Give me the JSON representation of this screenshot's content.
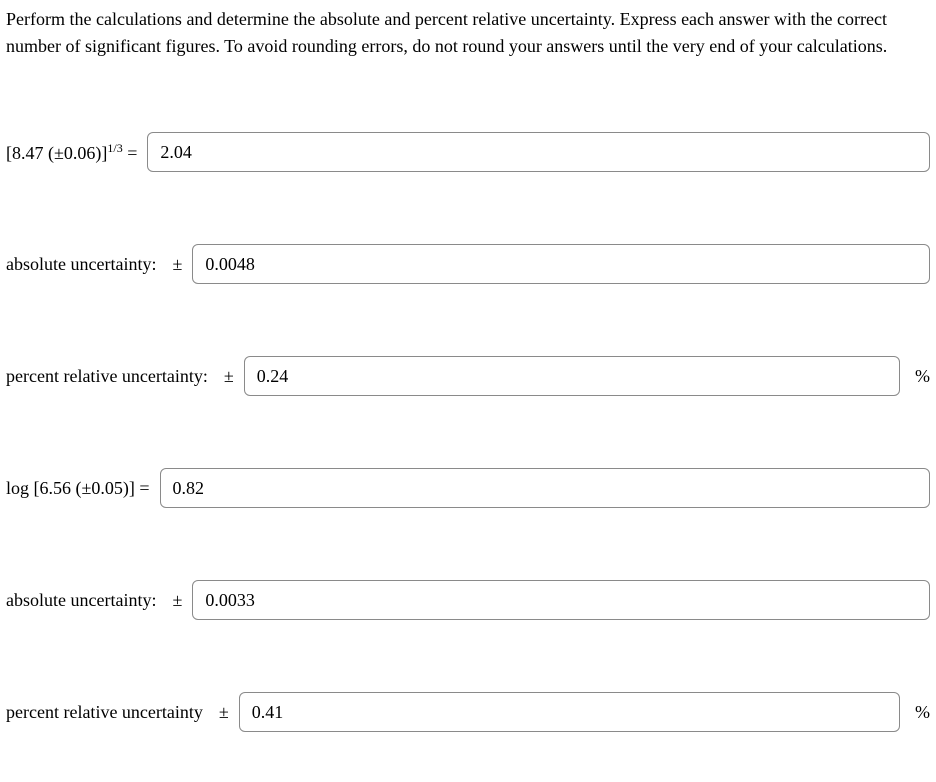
{
  "instructions": "Perform the calculations and determine the absolute and percent relative uncertainty. Express each answer with the correct number of significant figures. To avoid rounding errors, do not round your answers until the very end of your calculations.",
  "symbols": {
    "plus_minus": "±",
    "percent": "%"
  },
  "q1": {
    "expr_base": "[8.47 (±0.06)]",
    "expr_exp": "1/3",
    "equals": " =",
    "result_value": "2.04",
    "abs_label": "absolute uncertainty:",
    "abs_value": "0.0048",
    "pct_label": "percent relative uncertainty:",
    "pct_value": "0.24"
  },
  "q2": {
    "expr": "log [6.56 (±0.05)] =",
    "result_value": "0.82",
    "abs_label": "absolute uncertainty:",
    "abs_value": "0.0033",
    "pct_label": "percent relative uncertainty",
    "pct_value": "0.41"
  }
}
